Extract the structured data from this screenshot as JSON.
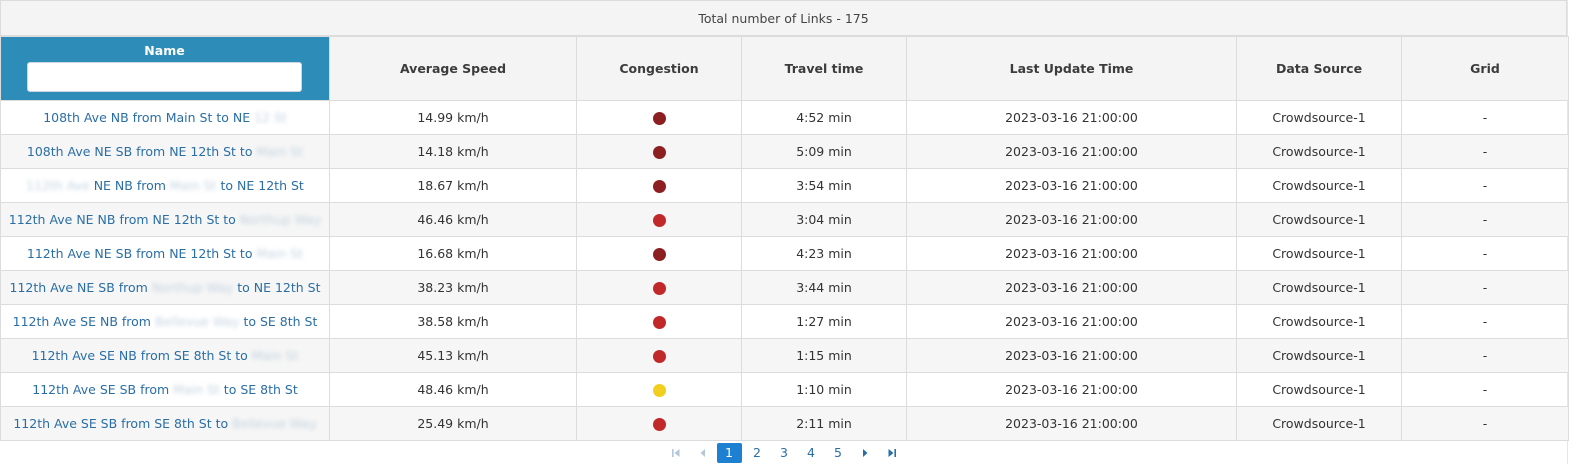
{
  "summary": {
    "text": "Total number of Links - 175"
  },
  "table": {
    "headers": {
      "name": "Name",
      "speed": "Average Speed",
      "congestion": "Congestion",
      "travel": "Travel time",
      "update": "Last Update Time",
      "source": "Data Source",
      "grid": "Grid"
    },
    "filter_value": "",
    "rows": [
      {
        "name_a": "108th Ave NB from Main St to NE ",
        "name_blur": "12 St",
        "name_b": "",
        "speed": "14.99 km/h",
        "congestion_color": "#8b1f22",
        "travel": "4:52 min",
        "update": "2023-03-16 21:00:00",
        "source": "Crowdsource-1",
        "grid": "-"
      },
      {
        "name_a": "108th Ave NE SB from NE 12th St to ",
        "name_blur": "Main St",
        "name_b": "",
        "speed": "14.18 km/h",
        "congestion_color": "#8b1f22",
        "travel": "5:09 min",
        "update": "2023-03-16 21:00:00",
        "source": "Crowdsource-1",
        "grid": "-"
      },
      {
        "name_a": "",
        "name_blur": "112th Ave",
        "name_b": " NE NB from ",
        "name_blur2": "Main St",
        "name_c": " to NE 12th St",
        "speed": "18.67 km/h",
        "congestion_color": "#8b1f22",
        "travel": "3:54 min",
        "update": "2023-03-16 21:00:00",
        "source": "Crowdsource-1",
        "grid": "-"
      },
      {
        "name_a": "112th Ave NE NB from NE 12th St to ",
        "name_blur": "Northup Way",
        "name_b": "",
        "speed": "46.46 km/h",
        "congestion_color": "#c0282a",
        "travel": "3:04 min",
        "update": "2023-03-16 21:00:00",
        "source": "Crowdsource-1",
        "grid": "-"
      },
      {
        "name_a": "112th Ave NE SB from NE 12th St to ",
        "name_blur": "Main St",
        "name_b": "",
        "speed": "16.68 km/h",
        "congestion_color": "#8b1f22",
        "travel": "4:23 min",
        "update": "2023-03-16 21:00:00",
        "source": "Crowdsource-1",
        "grid": "-"
      },
      {
        "name_a": "112th Ave NE SB from ",
        "name_blur": "Northup Way",
        "name_b": " to NE 12th St",
        "speed": "38.23 km/h",
        "congestion_color": "#c0282a",
        "travel": "3:44 min",
        "update": "2023-03-16 21:00:00",
        "source": "Crowdsource-1",
        "grid": "-"
      },
      {
        "name_a": "112th Ave SE NB from ",
        "name_blur": "Bellevue Way",
        "name_b": " to SE 8th St",
        "speed": "38.58 km/h",
        "congestion_color": "#c0282a",
        "travel": "1:27 min",
        "update": "2023-03-16 21:00:00",
        "source": "Crowdsource-1",
        "grid": "-"
      },
      {
        "name_a": "112th Ave SE NB from SE 8th St to ",
        "name_blur": "Main St",
        "name_b": "",
        "speed": "45.13 km/h",
        "congestion_color": "#c0282a",
        "travel": "1:15 min",
        "update": "2023-03-16 21:00:00",
        "source": "Crowdsource-1",
        "grid": "-"
      },
      {
        "name_a": "112th Ave SE SB from ",
        "name_blur": "Main St",
        "name_b": " to SE 8th St",
        "speed": "48.46 km/h",
        "congestion_color": "#f2cf1e",
        "travel": "1:10 min",
        "update": "2023-03-16 21:00:00",
        "source": "Crowdsource-1",
        "grid": "-"
      },
      {
        "name_a": "112th Ave SE SB from SE 8th St to ",
        "name_blur": "Bellevue Way",
        "name_b": "",
        "speed": "25.49 km/h",
        "congestion_color": "#c0282a",
        "travel": "2:11 min",
        "update": "2023-03-16 21:00:00",
        "source": "Crowdsource-1",
        "grid": "-"
      }
    ]
  },
  "pager": {
    "pages": [
      "1",
      "2",
      "3",
      "4",
      "5"
    ],
    "current": "1",
    "icons": {
      "first": "first-page-icon",
      "prev": "prev-page-icon",
      "next": "next-page-icon",
      "last": "last-page-icon"
    }
  },
  "colors": {
    "header_accent": "#2e8db8",
    "link": "#2a6ea6",
    "active_page": "#1d80d1"
  }
}
